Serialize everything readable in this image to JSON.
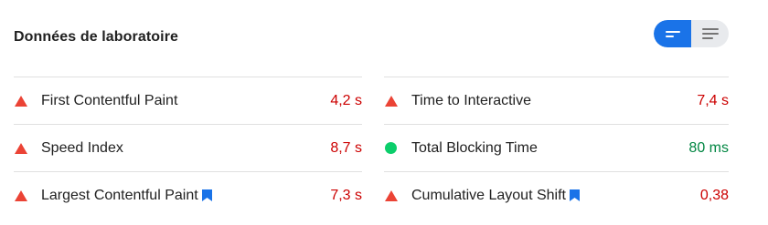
{
  "header": {
    "title": "Données de laboratoire"
  },
  "view_toggle": {
    "active": "summary",
    "accent_color": "#1a73e8",
    "icons": [
      "summary-view-icon",
      "list-view-icon"
    ]
  },
  "metrics": {
    "left": [
      {
        "label": "First Contentful Paint",
        "value": "4,2 s",
        "status": "bad",
        "indicator": "red-triangle-icon",
        "lcp_badge": false
      },
      {
        "label": "Speed Index",
        "value": "8,7 s",
        "status": "bad",
        "indicator": "red-triangle-icon",
        "lcp_badge": false
      },
      {
        "label": "Largest Contentful Paint",
        "value": "7,3 s",
        "status": "bad",
        "indicator": "red-triangle-icon",
        "lcp_badge": true
      }
    ],
    "right": [
      {
        "label": "Time to Interactive",
        "value": "7,4 s",
        "status": "bad",
        "indicator": "red-triangle-icon",
        "lcp_badge": false
      },
      {
        "label": "Total Blocking Time",
        "value": "80 ms",
        "status": "good",
        "indicator": "green-circle-icon",
        "lcp_badge": false
      },
      {
        "label": "Cumulative Layout Shift",
        "value": "0,38",
        "status": "bad",
        "indicator": "red-triangle-icon",
        "lcp_badge": true
      }
    ]
  },
  "colors": {
    "bad": "#cc0000",
    "good": "#018642",
    "triangle": "#eb4335",
    "circle": "#0cce6b",
    "bookmark": "#1a73e8"
  }
}
